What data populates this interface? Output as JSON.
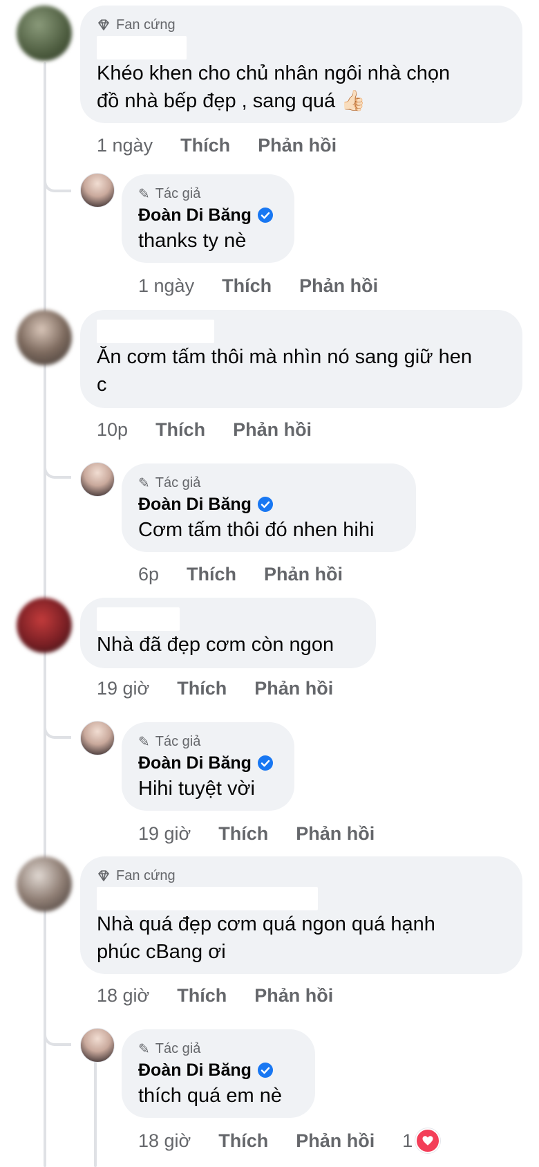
{
  "labels": {
    "like": "Thích",
    "reply": "Phản hồi",
    "fan_badge": "Fan cứng",
    "author_badge": "Tác giả",
    "author_name": "Đoàn Di Băng"
  },
  "colors": {
    "bubble_bg": "#f0f2f5",
    "secondary_text": "#65676b",
    "verified_blue": "#1877f2",
    "heart_red": "#f33e58"
  },
  "comments": [
    {
      "badge": "Fan cứng",
      "text_lines": [
        "Khéo khen cho chủ nhân ngôi nhà chọn",
        "đồ nhà bếp đẹp , sang quá 👍🏻"
      ],
      "time": "1 ngày",
      "reply": {
        "text": "thanks ty nè",
        "time": "1 ngày"
      }
    },
    {
      "badge": "",
      "text_lines": [
        "Ăn cơm tấm thôi mà nhìn nó sang giữ hen",
        "c"
      ],
      "time": "10p",
      "reply": {
        "text": "Cơm tấm thôi đó nhen hihi",
        "time": "6p"
      }
    },
    {
      "badge": "",
      "text_lines": [
        "Nhà đã đẹp cơm còn ngon"
      ],
      "time": "19 giờ",
      "reply": {
        "text": "Hihi tuyệt vời",
        "time": "19 giờ"
      }
    },
    {
      "badge": "Fan cứng",
      "text_lines": [
        "Nhà quá đẹp cơm quá ngon quá hạnh",
        "phúc cBang ơi"
      ],
      "time": "18 giờ",
      "reply": {
        "text": "thích quá em nè",
        "time": "18 giờ",
        "reaction_count": "1"
      }
    }
  ]
}
